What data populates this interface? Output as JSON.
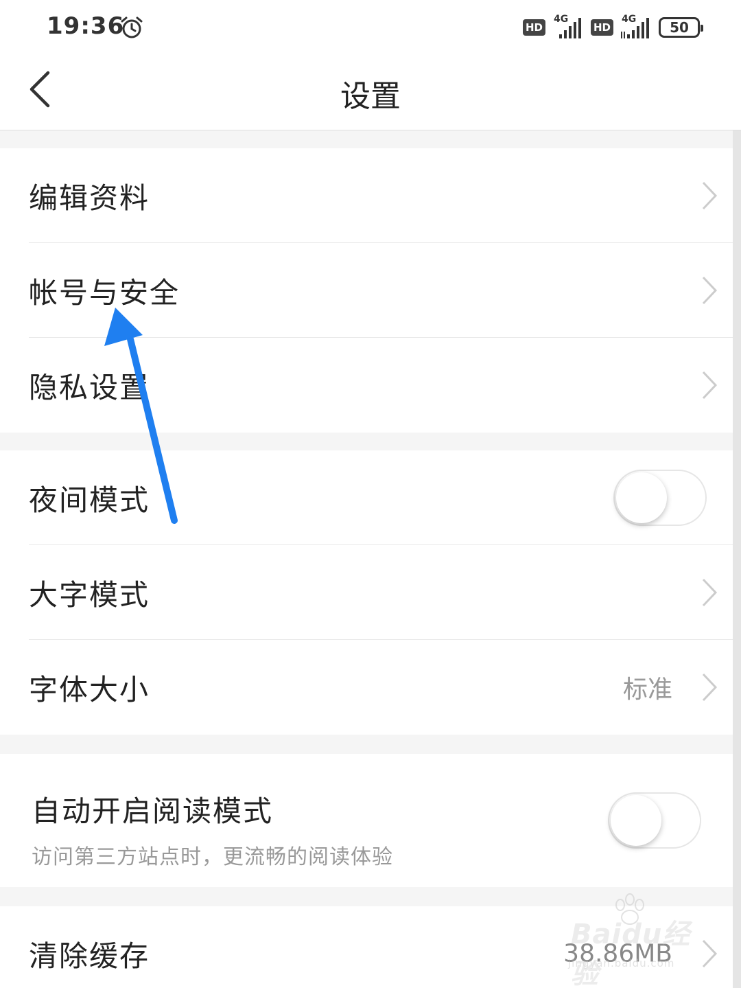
{
  "status_bar": {
    "time": "19:36",
    "hd1": "HD",
    "net1": "4G",
    "hd2": "HD",
    "net2": "4G",
    "battery": "50"
  },
  "nav": {
    "title": "设置"
  },
  "group1": {
    "items": [
      {
        "label": "编辑资料"
      },
      {
        "label": "帐号与安全"
      },
      {
        "label": "隐私设置"
      }
    ]
  },
  "group2": {
    "night_mode": {
      "label": "夜间模式",
      "on": false
    },
    "large_text": {
      "label": "大字模式"
    },
    "font_size": {
      "label": "字体大小",
      "value": "标准"
    }
  },
  "group3": {
    "auto_read": {
      "label": "自动开启阅读模式",
      "sublabel": "访问第三方站点时，更流畅的阅读体验",
      "on": false
    }
  },
  "group4": {
    "clear_cache": {
      "label": "清除缓存",
      "value": "38.86MB"
    }
  },
  "watermark": {
    "line1": "Baidu经验",
    "line2": "jingyan.baidu.com"
  },
  "colors": {
    "arrow": "#1f7ff0",
    "chevron": "#cccccc"
  }
}
